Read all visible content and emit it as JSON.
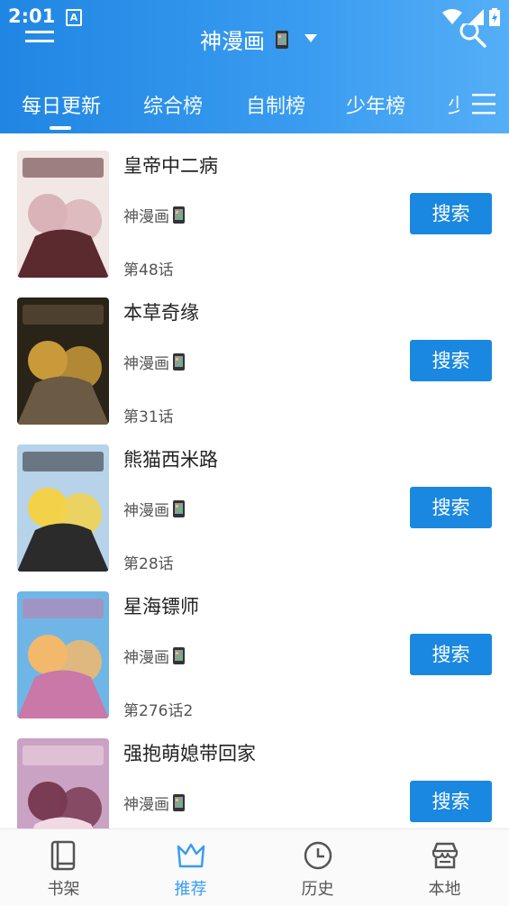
{
  "status_bar": {
    "time": "2:01",
    "badge": "A"
  },
  "app_bar": {
    "title": "神漫画"
  },
  "tabs": [
    {
      "label": "每日更新",
      "active": true
    },
    {
      "label": "综合榜",
      "active": false
    },
    {
      "label": "自制榜",
      "active": false
    },
    {
      "label": "少年榜",
      "active": false
    },
    {
      "label": "少",
      "active": false
    }
  ],
  "items": [
    {
      "title": "皇帝中二病",
      "source": "神漫画",
      "chapter": "第48话",
      "button": "搜索",
      "cover_colors": [
        "#f1e7e4",
        "#d9b3b8",
        "#5a2a2f"
      ]
    },
    {
      "title": "本草奇缘",
      "source": "神漫画",
      "chapter": "第31话",
      "button": "搜索",
      "cover_colors": [
        "#2a2318",
        "#c99a3a",
        "#6b5a44"
      ]
    },
    {
      "title": "熊猫西米路",
      "source": "神漫画",
      "chapter": "第28话",
      "button": "搜索",
      "cover_colors": [
        "#b7d3ea",
        "#f3d24a",
        "#2b2b2b"
      ]
    },
    {
      "title": "星海镖师",
      "source": "神漫画",
      "chapter": "第276话2",
      "button": "搜索",
      "cover_colors": [
        "#6fb6e6",
        "#f2b86b",
        "#c978a8"
      ]
    },
    {
      "title": "强抱萌媳带回家",
      "source": "神漫画",
      "chapter": "",
      "button": "搜索",
      "cover_colors": [
        "#caa2c4",
        "#7a3b54",
        "#f3d9e4"
      ]
    }
  ],
  "bottom_nav": [
    {
      "label": "书架",
      "icon": "bookshelf-icon",
      "active": false
    },
    {
      "label": "推荐",
      "icon": "recommend-crown-icon",
      "active": true
    },
    {
      "label": "历史",
      "icon": "history-clock-icon",
      "active": false
    },
    {
      "label": "本地",
      "icon": "local-store-icon",
      "active": false
    }
  ],
  "colors": {
    "accent": "#1a88e0",
    "header_start": "#2086e3",
    "header_end": "#55aef7",
    "nav_active": "#3a9cf0"
  }
}
